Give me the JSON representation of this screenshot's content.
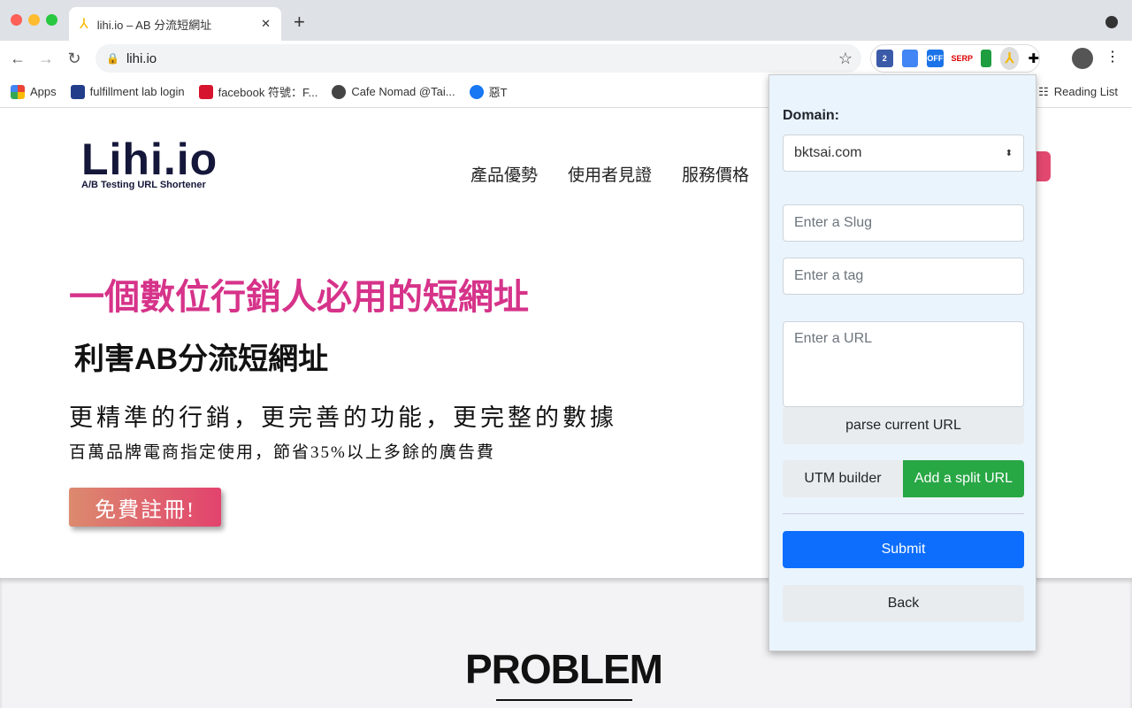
{
  "browser": {
    "tab_title": "lihi.io – AB 分流短網址",
    "url": "lihi.io",
    "ext_badge": "2",
    "ext_off": "OFF",
    "ext_serp": "SERP",
    "bookmarks": [
      {
        "label": "Apps"
      },
      {
        "label": "fulfillment lab login"
      },
      {
        "label": "facebook 符號：F..."
      },
      {
        "label": "Cafe Nomad @Tai..."
      },
      {
        "label": "惡T"
      }
    ],
    "reading_list": "Reading List"
  },
  "site": {
    "logo": "Lihi.io",
    "logo_sub": "A/B Testing URL Shortener",
    "nav": [
      "產品優勢",
      "使用者見證",
      "服務價格"
    ],
    "headline": "一個數位行銷人必用的短網址",
    "subheadline": "利害AB分流短網址",
    "tagline": "更精準的行銷，更完善的功能，更完整的數據",
    "desc": "百萬品牌電商指定使用，節省35%以上多餘的廣告費",
    "cta": "免費註冊!",
    "section_title": "PROBLEM"
  },
  "popup": {
    "domain_label": "Domain:",
    "domain_value": "bktsai.com",
    "slug_placeholder": "Enter a Slug",
    "tag_placeholder": "Enter a tag",
    "url_placeholder": "Enter a URL",
    "parse": "parse current URL",
    "utm": "UTM builder",
    "split": "Add a split URL",
    "submit": "Submit",
    "back": "Back"
  },
  "colors": {
    "accent": "#0d6efd",
    "green": "#28a745",
    "pink": "#d6338a"
  }
}
